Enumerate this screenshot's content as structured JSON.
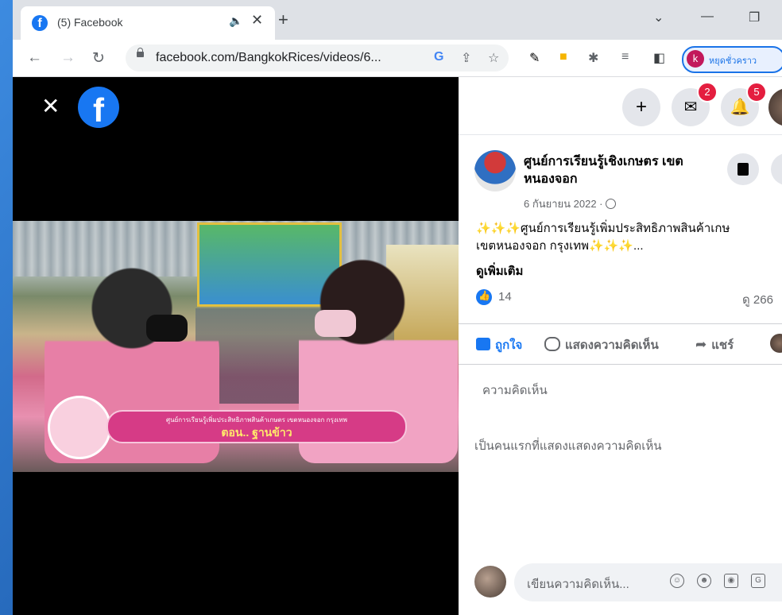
{
  "browser": {
    "tab_title": "(5) Facebook",
    "tab_close": "✕",
    "new_tab": "+",
    "win_dropdown": "⌄",
    "win_minimize": "—",
    "win_restore": "❐",
    "nav_back": "←",
    "nav_forward": "→",
    "nav_reload": "↻",
    "url": "facebook.com/BangkokRices/videos/6...",
    "profile_initial": "k",
    "profile_label": "หยุดชั่วคราว"
  },
  "video": {
    "close": "✕",
    "logo_letter": "f",
    "banner_line1": "ศูนย์การเรียนรู้เพิ่มประสิทธิภาพสินค้าเกษตร เขตหนองจอก กรุงเทพ",
    "banner_line2": "ตอน.. ฐานข้าว"
  },
  "fb_header": {
    "plus": "+",
    "messenger_badge": "2",
    "notif_badge": "5"
  },
  "post": {
    "page_name": "ศูนย์การเรียนรู้เชิงเกษตร เขตหนองจอก",
    "date": "6 กันยายน 2022 ·",
    "text_line1": "ศูนย์การเรียนรู้เพิ่มประสิทธิภาพสินค้าเกษ",
    "text_line2": "เขตหนองจอก กรุงเทพ",
    "sparkles": "✨✨✨",
    "ellipsis": "...",
    "see_more": "ดูเพิ่มเติม",
    "like_count": "14",
    "views": "ดู 266",
    "action_like": "ถูกใจ",
    "action_comment": "แสดงความคิดเห็น",
    "action_share": "แชร์",
    "comments_label": "ความคิดเห็น",
    "first_comment": "เป็นคนแรกที่แสดงแสดงความคิดเห็น",
    "composer_placeholder": "เขียนความคิดเห็น..."
  },
  "colors": {
    "facebook_blue": "#1877f2",
    "badge_red": "#e41e3f",
    "banner_pink": "#d63b86"
  }
}
